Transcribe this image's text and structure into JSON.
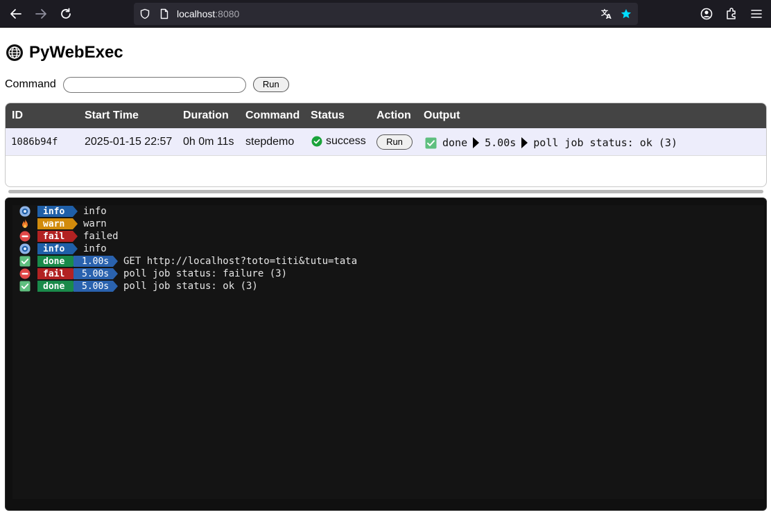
{
  "browser": {
    "url_host": "localhost",
    "url_port": ":8080"
  },
  "page": {
    "title": "PyWebExec"
  },
  "command_form": {
    "label": "Command",
    "input_value": "",
    "run_label": "Run"
  },
  "jobs_table": {
    "headers": [
      "ID",
      "Start Time",
      "Duration",
      "Command",
      "Status",
      "Action",
      "Output"
    ],
    "rows": [
      {
        "id": "1086b94f",
        "start_time": "2025-01-15 22:57",
        "duration": "0h 0m 11s",
        "command": "stepdemo",
        "status": "success",
        "action_label": "Run",
        "output": {
          "state": "done",
          "elapsed": "5.00s",
          "message": "poll job status: ok (3)"
        }
      }
    ]
  },
  "terminal": {
    "lines": [
      {
        "icon": "info-icon",
        "level": "info",
        "duration": "",
        "message": "info"
      },
      {
        "icon": "fire-icon",
        "level": "warn",
        "duration": "",
        "message": "warn"
      },
      {
        "icon": "no-entry-icon",
        "level": "fail",
        "duration": "",
        "message": "failed"
      },
      {
        "icon": "info-icon",
        "level": "info",
        "duration": "",
        "message": "info"
      },
      {
        "icon": "check-box-icon",
        "level": "done",
        "duration": "1.00s",
        "message": "GET http://localhost?toto=titi&tutu=tata"
      },
      {
        "icon": "no-entry-icon",
        "level": "fail",
        "duration": "5.00s",
        "message": "poll job status: failure (3)"
      },
      {
        "icon": "check-box-icon",
        "level": "done",
        "duration": "5.00s",
        "message": "poll job status: ok (3)"
      }
    ]
  },
  "colors": {
    "info": "#1f5fa8",
    "warn": "#d28b0c",
    "fail": "#b22222",
    "done": "#1a8a4a",
    "duration": "#2a62ae",
    "table_header": "#444444",
    "row_highlight": "#ededfb",
    "terminal_bg": "#101010"
  }
}
